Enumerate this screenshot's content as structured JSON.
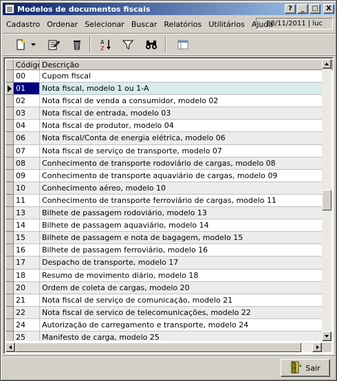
{
  "window": {
    "title": "Modelos de documentos fiscais",
    "controls": [
      "?",
      "_",
      "□",
      "X"
    ]
  },
  "menu": {
    "items": [
      "Cadastro",
      "Ordenar",
      "Selecionar",
      "Buscar",
      "Relatórios",
      "Utilitários",
      "Ajuda"
    ],
    "status": "28/11/2011 | luc"
  },
  "toolbar": {
    "icons": [
      "new-record-icon",
      "dropdown-arrow-icon",
      "edit-record-icon",
      "delete-icon",
      "sort-az-icon",
      "filter-icon",
      "binoculars-icon",
      "layout-icon"
    ]
  },
  "grid": {
    "headers": {
      "code": "Código",
      "description": "Descrição"
    },
    "selected_index": 1,
    "rows": [
      {
        "code": "00",
        "description": "Cupom fiscal"
      },
      {
        "code": "01",
        "description": "Nota fiscal, modelo 1 ou 1-A"
      },
      {
        "code": "02",
        "description": "Nota fiscal de venda a consumidor, modelo 02"
      },
      {
        "code": "03",
        "description": "Nota fiscal de entrada, modelo 03"
      },
      {
        "code": "04",
        "description": "Nota fiscal de produtor, modelo 04"
      },
      {
        "code": "06",
        "description": "Nota fiscal/Conta de energia elétrica, modelo 06"
      },
      {
        "code": "07",
        "description": "Nota fiscal de serviço de transporte, modelo 07"
      },
      {
        "code": "08",
        "description": "Conhecimento de transporte rodoviário de cargas, modelo 08"
      },
      {
        "code": "09",
        "description": "Conhecimento de transporte aquaviário de cargas, modelo 09"
      },
      {
        "code": "10",
        "description": "Conhecimento aéreo, modelo 10"
      },
      {
        "code": "11",
        "description": "Conhecimento de transporte ferroviário de cargas, modelo 11"
      },
      {
        "code": "13",
        "description": "Bilhete de passagem rodoviário, modelo 13"
      },
      {
        "code": "14",
        "description": "Bilhete de passagem aquaviário, modelo 14"
      },
      {
        "code": "15",
        "description": "Bilhete de passagem e nota de bagagem, modelo 15"
      },
      {
        "code": "16",
        "description": "Bilhete de passagem ferroviário, modelo 16"
      },
      {
        "code": "17",
        "description": "Despacho de transporte, modelo 17"
      },
      {
        "code": "18",
        "description": "Resumo de movimento diário, modelo 18"
      },
      {
        "code": "20",
        "description": "Ordem de coleta de cargas, modelo 20"
      },
      {
        "code": "21",
        "description": "Nota fiscal de serviço de comunicação, modelo 21"
      },
      {
        "code": "22",
        "description": "Nota fiscal de servico de telecomunicações, modelo 22"
      },
      {
        "code": "24",
        "description": "Autorização de carregamento e transporte, modelo 24"
      },
      {
        "code": "25",
        "description": "Manifesto de carga, modelo 25"
      }
    ]
  },
  "footer": {
    "exit_label": "Sair"
  }
}
